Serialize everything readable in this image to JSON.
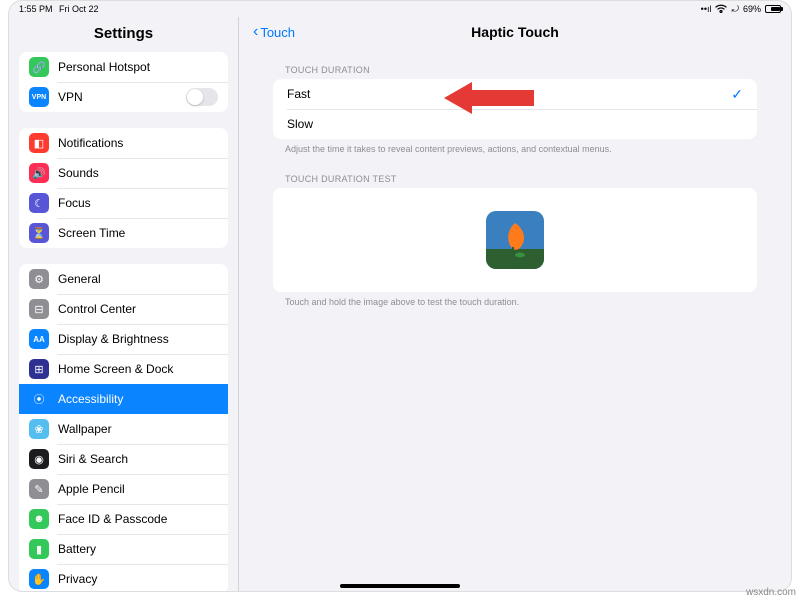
{
  "status": {
    "time": "1:55 PM",
    "date": "Fri Oct 22",
    "battery_pct": "69%"
  },
  "sidebar": {
    "title": "Settings",
    "group1": [
      {
        "label": "Personal Hotspot",
        "icon_bg": "#34c759",
        "glyph": "🔗"
      },
      {
        "label": "VPN",
        "icon_bg": "#0a84ff",
        "glyph": "VPN",
        "toggle": true
      }
    ],
    "group2": [
      {
        "label": "Notifications",
        "icon_bg": "#ff3b30",
        "glyph": "◧"
      },
      {
        "label": "Sounds",
        "icon_bg": "#ff2d55",
        "glyph": "🔊"
      },
      {
        "label": "Focus",
        "icon_bg": "#5856d6",
        "glyph": "☾"
      },
      {
        "label": "Screen Time",
        "icon_bg": "#5856d6",
        "glyph": "⏳"
      }
    ],
    "group3": [
      {
        "label": "General",
        "icon_bg": "#8e8e93",
        "glyph": "⚙"
      },
      {
        "label": "Control Center",
        "icon_bg": "#8e8e93",
        "glyph": "⊟"
      },
      {
        "label": "Display & Brightness",
        "icon_bg": "#0a84ff",
        "glyph": "AA"
      },
      {
        "label": "Home Screen & Dock",
        "icon_bg": "#2e3192",
        "glyph": "⊞"
      },
      {
        "label": "Accessibility",
        "icon_bg": "#0a84ff",
        "glyph": "⦿",
        "selected": true
      },
      {
        "label": "Wallpaper",
        "icon_bg": "#55bef0",
        "glyph": "❀"
      },
      {
        "label": "Siri & Search",
        "icon_bg": "#1c1c1e",
        "glyph": "◉"
      },
      {
        "label": "Apple Pencil",
        "icon_bg": "#8e8e93",
        "glyph": "✎"
      },
      {
        "label": "Face ID & Passcode",
        "icon_bg": "#34c759",
        "glyph": "☻"
      },
      {
        "label": "Battery",
        "icon_bg": "#34c759",
        "glyph": "▮"
      },
      {
        "label": "Privacy",
        "icon_bg": "#0a84ff",
        "glyph": "✋"
      }
    ]
  },
  "main": {
    "back_label": "Touch",
    "title": "Haptic Touch",
    "duration_header": "TOUCH DURATION",
    "duration_options": {
      "fast": "Fast",
      "slow": "Slow"
    },
    "duration_footer": "Adjust the time it takes to reveal content previews, actions, and contextual menus.",
    "test_header": "TOUCH DURATION TEST",
    "test_footer": "Touch and hold the image above to test the touch duration."
  },
  "watermark": "wsxdn.com"
}
